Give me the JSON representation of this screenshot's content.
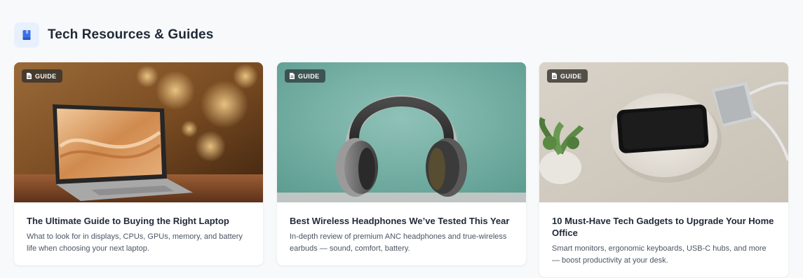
{
  "section": {
    "title": "Tech Resources & Guides",
    "icon": "book-icon",
    "accent_color": "#3b6fe8"
  },
  "cards": [
    {
      "badge": "GUIDE",
      "badge_icon": "document-icon",
      "image": "laptop-image",
      "title": "The Ultimate Guide to Buying the Right Laptop",
      "description": "What to look for in displays, CPUs, GPUs, memory, and battery life when choosing your next laptop."
    },
    {
      "badge": "GUIDE",
      "badge_icon": "document-icon",
      "image": "headphones-image",
      "title": "Best Wireless Headphones We’ve Tested This Year",
      "description": "In-depth review of premium ANC headphones and true-wireless earbuds — sound, comfort, battery."
    },
    {
      "badge": "GUIDE",
      "badge_icon": "document-icon",
      "image": "gadgets-image",
      "title": "10 Must-Have Tech Gadgets to Upgrade Your Home Office",
      "description": "Smart monitors, ergonomic keyboards, USB-C hubs, and more — boost productivity at your desk."
    }
  ]
}
